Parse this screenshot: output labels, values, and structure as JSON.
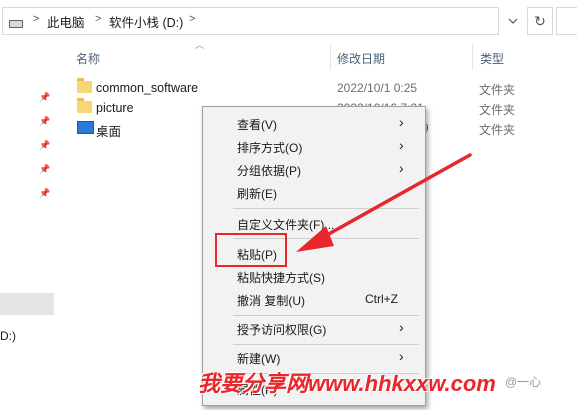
{
  "address": {
    "crumbs": [
      "此电脑",
      "软件小栈 (D:)"
    ],
    "separator": ">",
    "dropdown_icon": "chevron-down-icon",
    "refresh_glyph": "↻"
  },
  "nav": {
    "drive_label": "D:)"
  },
  "columns": {
    "name": "名称",
    "date": "修改日期",
    "type": "类型"
  },
  "files": [
    {
      "name": "common_software",
      "date": "2022/10/1 0:25",
      "type": "文件夹",
      "icon": "folder-icon"
    },
    {
      "name": "picture",
      "date": "2022/10/16 7:21",
      "type": "文件夹",
      "icon": "folder-icon"
    },
    {
      "name": "桌面",
      "date": "9",
      "type": "文件夹",
      "icon": "desktop-icon"
    }
  ],
  "menu": {
    "items": [
      {
        "label": "查看(V)",
        "submenu": true
      },
      {
        "label": "排序方式(O)",
        "submenu": true
      },
      {
        "label": "分组依据(P)",
        "submenu": true
      },
      {
        "label": "刷新(E)",
        "submenu": false
      },
      {
        "label": "自定义文件夹(F)...",
        "submenu": false
      },
      {
        "label": "粘贴(P)",
        "submenu": false
      },
      {
        "label": "粘贴快捷方式(S)",
        "submenu": false
      },
      {
        "label": "撤消 复制(U)",
        "submenu": false,
        "shortcut": "Ctrl+Z"
      },
      {
        "label": "授予访问权限(G)",
        "submenu": true
      },
      {
        "label": "新建(W)",
        "submenu": true
      },
      {
        "label": "属性(R)",
        "submenu": false
      }
    ],
    "submenu_glyph": "›"
  },
  "annotation": {
    "color": "#e8262b",
    "watermark": "我要分享网www.hhkxxw.com",
    "credit": "@一心"
  }
}
